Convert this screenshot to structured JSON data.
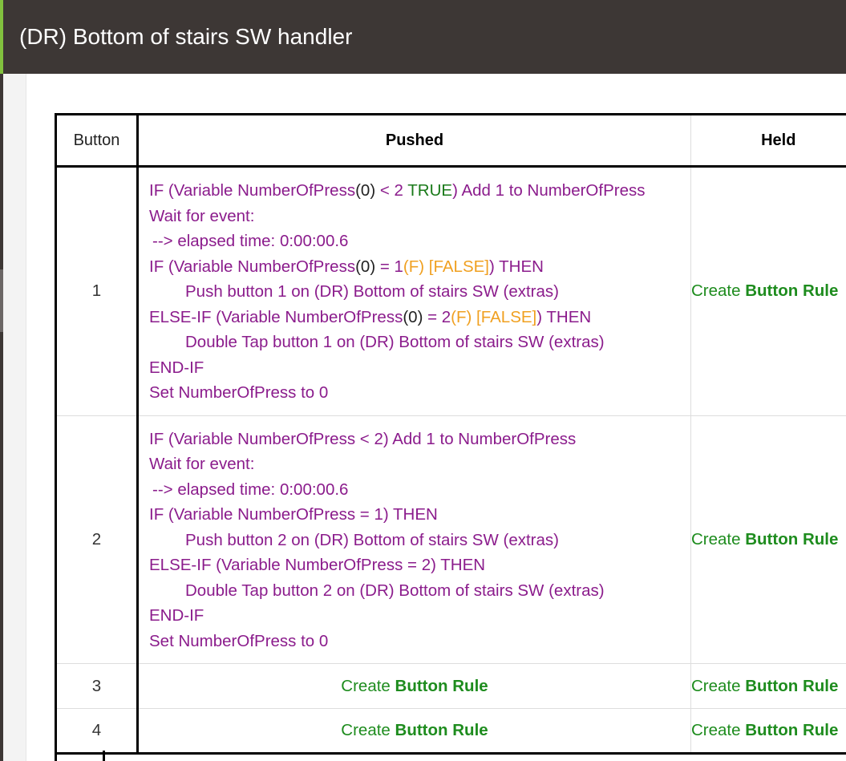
{
  "header": {
    "title": "(DR) Bottom of stairs SW handler",
    "bg": "#3d3735",
    "accent": "#81c13e"
  },
  "table": {
    "headers": {
      "button": "Button",
      "pushed": "Pushed",
      "held": "Held"
    },
    "create_prefix": "Create",
    "create_bold": "Button Rule",
    "rows": [
      {
        "num": "1",
        "pushed": {
          "l1": {
            "a": "IF (Variable NumberOfPress",
            "b": "(0)",
            "c": " < 2 ",
            "d": "TRUE",
            "e": ") Add 1 to NumberOfPress"
          },
          "l2": "Wait for event:",
          "l3": "--> elapsed time: 0:00:00.6",
          "l4": {
            "a": "IF (Variable NumberOfPress",
            "b": "(0)",
            "c": " = 1",
            "d": "(F) [FALSE]",
            "e": ") THEN"
          },
          "l5": "Push button 1 on (DR) Bottom of stairs SW (extras)",
          "l6": {
            "a": "ELSE-IF (Variable NumberOfPress",
            "b": "(0)",
            "c": " = 2",
            "d": "(F) [FALSE]",
            "e": ") THEN"
          },
          "l7": "Double Tap button 1 on (DR) Bottom of stairs SW (extras)",
          "l8": "END-IF",
          "l9": "Set NumberOfPress to 0"
        }
      },
      {
        "num": "2",
        "pushed": {
          "l1": "IF (Variable NumberOfPress < 2) Add 1 to NumberOfPress",
          "l2": "Wait for event:",
          "l3": "--> elapsed time: 0:00:00.6",
          "l4": "IF (Variable NumberOfPress = 1) THEN",
          "l5": "Push button 2 on (DR) Bottom of stairs SW (extras)",
          "l6": "ELSE-IF (Variable NumberOfPress = 2) THEN",
          "l7": "Double Tap button 2 on (DR) Bottom of stairs SW (extras)",
          "l8": "END-IF",
          "l9": "Set NumberOfPress to 0"
        }
      },
      {
        "num": "3"
      },
      {
        "num": "4"
      }
    ]
  }
}
